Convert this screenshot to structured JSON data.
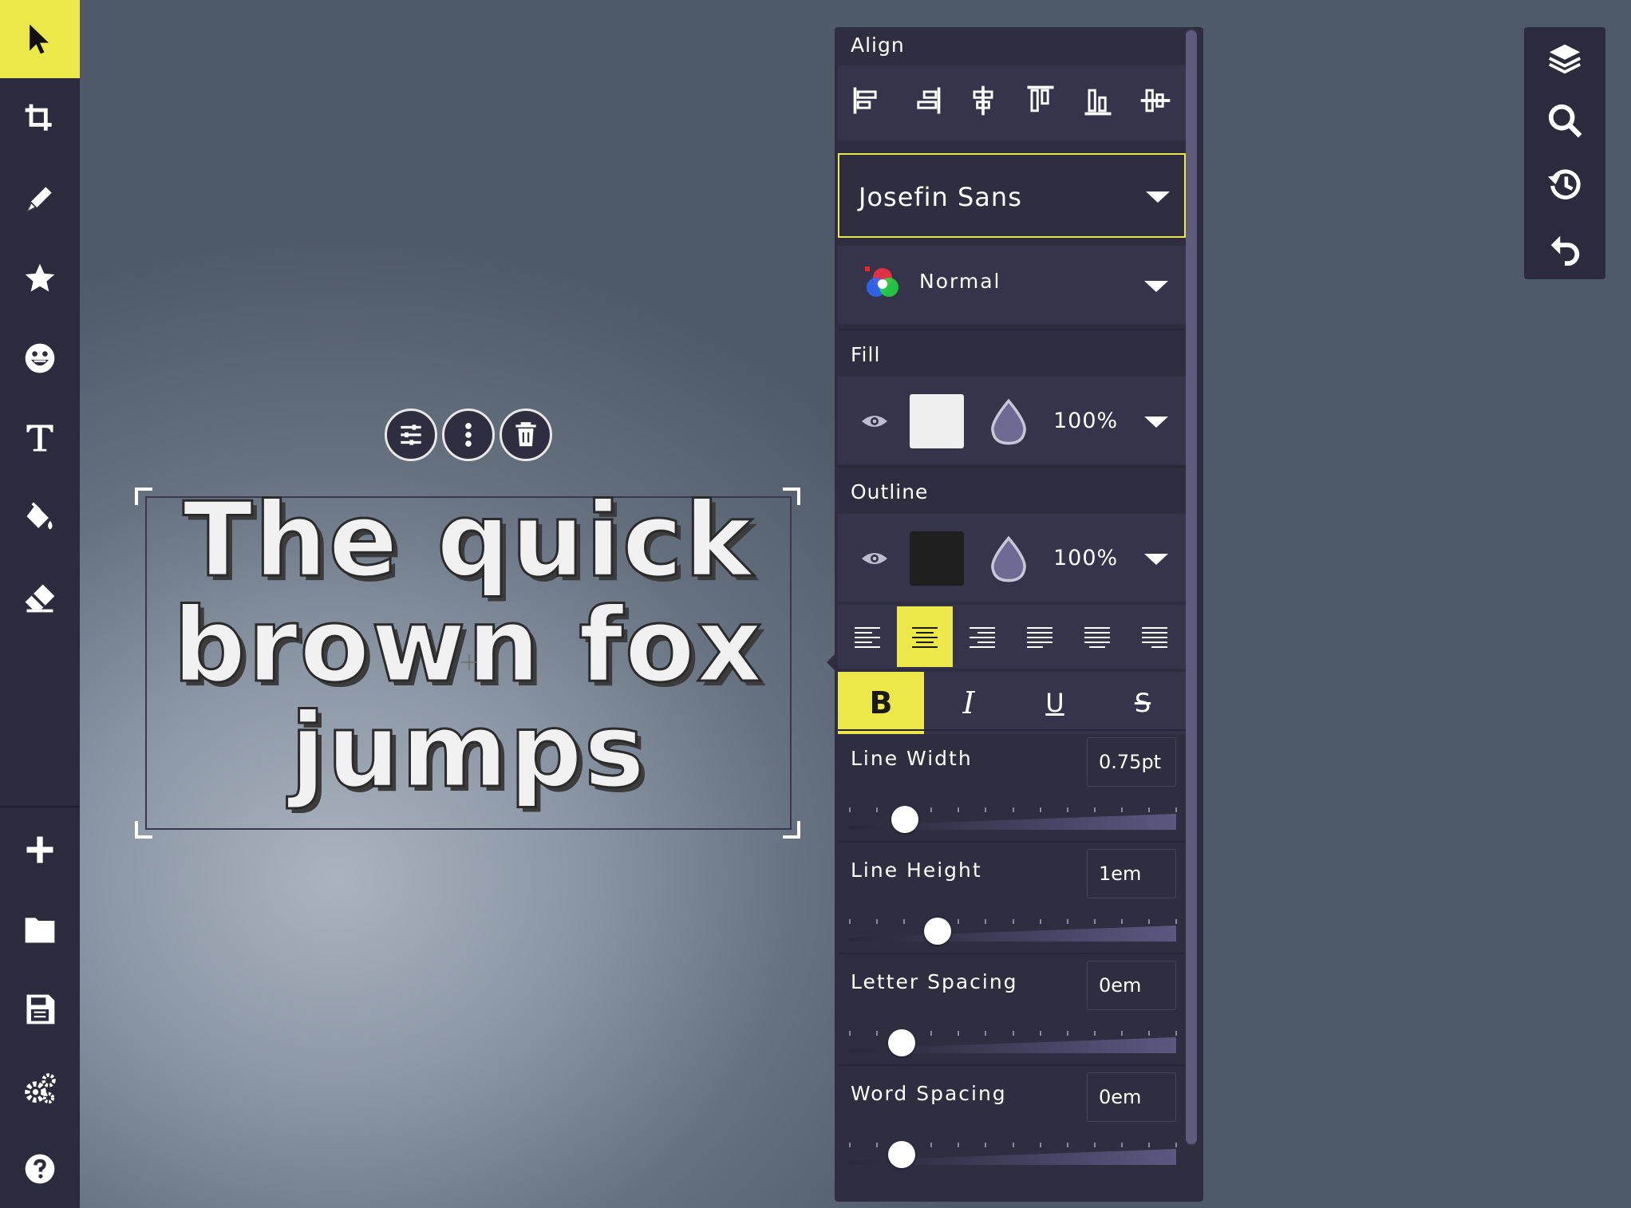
{
  "left_toolbar": {
    "tools": [
      {
        "name": "select",
        "icon": "pointer-arrow-icon",
        "active": true
      },
      {
        "name": "crop",
        "icon": "crop-icon"
      },
      {
        "name": "draw",
        "icon": "pen-icon"
      },
      {
        "name": "shapes",
        "icon": "star-icon"
      },
      {
        "name": "stickers",
        "icon": "emoji-icon"
      },
      {
        "name": "text",
        "icon": "text-t-icon"
      },
      {
        "name": "fill",
        "icon": "paint-bucket-icon"
      },
      {
        "name": "eraser",
        "icon": "eraser-icon"
      }
    ],
    "bottom_tools": [
      {
        "name": "new",
        "icon": "plus-icon"
      },
      {
        "name": "open",
        "icon": "folder-icon"
      },
      {
        "name": "save",
        "icon": "floppy-disk-icon"
      },
      {
        "name": "settings",
        "icon": "gears-icon"
      },
      {
        "name": "help",
        "icon": "help-circle-icon"
      }
    ],
    "active_color": "#ece84a"
  },
  "canvas": {
    "text_lines": [
      "The quick",
      "brown fox",
      "jumps"
    ],
    "object_buttons": [
      "sliders-icon",
      "more-vertical-icon",
      "trash-icon"
    ]
  },
  "panel": {
    "align_header": "Align",
    "align_icons": [
      "align-left-icon",
      "align-right-icon",
      "align-center-horizontal-icon",
      "align-top-icon",
      "align-bottom-icon",
      "align-center-vertical-icon"
    ],
    "font_family": "Josefin Sans",
    "blend_mode": "Normal",
    "fill": {
      "header": "Fill",
      "color": "#efefef",
      "opacity": "100%"
    },
    "outline": {
      "header": "Outline",
      "color": "#1f1f1f",
      "opacity": "100%"
    },
    "text_align": {
      "options": [
        "left",
        "center",
        "right",
        "justify-left",
        "justify-center",
        "justify-right"
      ],
      "active": "center"
    },
    "format": {
      "bold": "B",
      "italic": "I",
      "underline": "U",
      "strike": "S",
      "active": "bold"
    },
    "sliders": [
      {
        "label": "Line Width",
        "value": "0.75pt",
        "position": 0.17
      },
      {
        "label": "Line Height",
        "value": "1em",
        "position": 0.27
      },
      {
        "label": "Letter Spacing",
        "value": "0em",
        "position": 0.16
      },
      {
        "label": "Word Spacing",
        "value": "0em",
        "position": 0.16
      }
    ]
  },
  "right_toolbar": {
    "tools": [
      "layers-icon",
      "search-icon",
      "history-icon",
      "undo-icon"
    ]
  }
}
